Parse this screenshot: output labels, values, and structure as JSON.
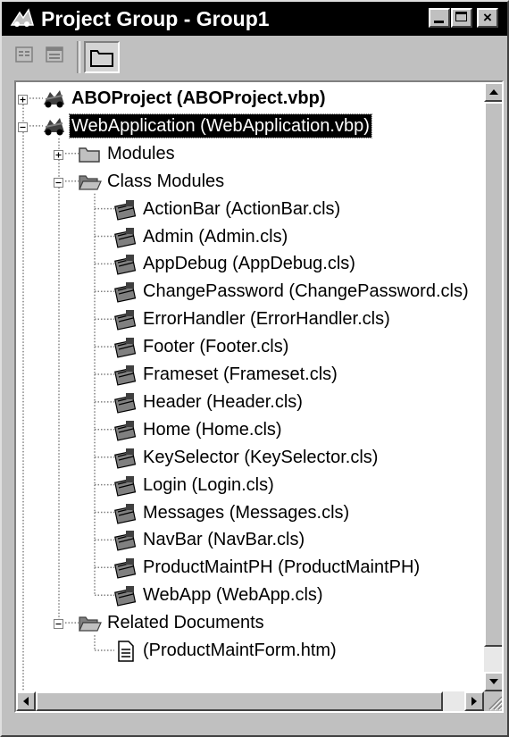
{
  "window": {
    "title": "Project Group - Group1",
    "caption_buttons": {
      "minimize": "minimize",
      "maximize": "maximize",
      "close": "×"
    }
  },
  "toolbar": {
    "buttons": [
      {
        "name": "view-object",
        "icon": "view-object-icon"
      },
      {
        "name": "view-form",
        "icon": "view-form-icon"
      },
      {
        "name": "toggle-folders",
        "icon": "folder-icon",
        "pressed": true
      }
    ]
  },
  "tree": {
    "nodes": [
      {
        "label": "ABOProject (ABOProject.vbp)",
        "level": 0,
        "type": "project",
        "expander": "+",
        "bold": true
      },
      {
        "label": "WebApplication (WebApplication.vbp)",
        "level": 0,
        "type": "project",
        "expander": "-",
        "selected": true
      },
      {
        "label": "Modules",
        "level": 1,
        "type": "folder-closed",
        "expander": "+"
      },
      {
        "label": "Class Modules",
        "level": 1,
        "type": "folder-open",
        "expander": "-"
      },
      {
        "label": "ActionBar (ActionBar.cls)",
        "level": 2,
        "type": "class"
      },
      {
        "label": "Admin (Admin.cls)",
        "level": 2,
        "type": "class"
      },
      {
        "label": "AppDebug (AppDebug.cls)",
        "level": 2,
        "type": "class"
      },
      {
        "label": "ChangePassword (ChangePassword.cls)",
        "level": 2,
        "type": "class"
      },
      {
        "label": "ErrorHandler (ErrorHandler.cls)",
        "level": 2,
        "type": "class"
      },
      {
        "label": "Footer (Footer.cls)",
        "level": 2,
        "type": "class"
      },
      {
        "label": "Frameset (Frameset.cls)",
        "level": 2,
        "type": "class"
      },
      {
        "label": "Header (Header.cls)",
        "level": 2,
        "type": "class"
      },
      {
        "label": "Home (Home.cls)",
        "level": 2,
        "type": "class"
      },
      {
        "label": "KeySelector (KeySelector.cls)",
        "level": 2,
        "type": "class"
      },
      {
        "label": "Login (Login.cls)",
        "level": 2,
        "type": "class"
      },
      {
        "label": "Messages (Messages.cls)",
        "level": 2,
        "type": "class"
      },
      {
        "label": "NavBar (NavBar.cls)",
        "level": 2,
        "type": "class"
      },
      {
        "label": "ProductMaintPH (ProductMaintPH)",
        "level": 2,
        "type": "class"
      },
      {
        "label": "WebApp (WebApp.cls)",
        "level": 2,
        "type": "class"
      },
      {
        "label": "Related Documents",
        "level": 1,
        "type": "folder-open",
        "expander": "-"
      },
      {
        "label": " (ProductMaintForm.htm)",
        "level": 2,
        "type": "document"
      }
    ]
  },
  "colors": {
    "titlebar": "#000000",
    "face": "#c0c0c0",
    "selection": "#000000",
    "tree_background": "#ffffff"
  }
}
